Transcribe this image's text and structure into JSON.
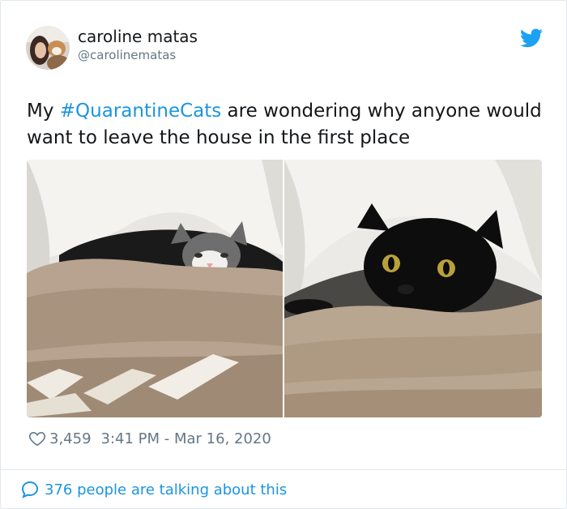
{
  "author": {
    "display_name": "caroline matas",
    "handle": "@carolinematas"
  },
  "tweet": {
    "text_before": "My ",
    "hashtag": "#QuarantineCats",
    "text_after": " are wondering why anyone would want to leave the house in the first place"
  },
  "stats": {
    "likes": "3,459",
    "timestamp": "3:41 PM - Mar 16, 2020"
  },
  "footer": {
    "conversation_label": "376 people are talking about this"
  },
  "icons": {
    "brand": "twitter-bird-icon",
    "like": "heart-icon",
    "reply": "speech-bubble-icon"
  },
  "colors": {
    "link": "#1b95e0",
    "muted": "#657786",
    "text": "#14171a",
    "border": "#e1e8ed"
  }
}
